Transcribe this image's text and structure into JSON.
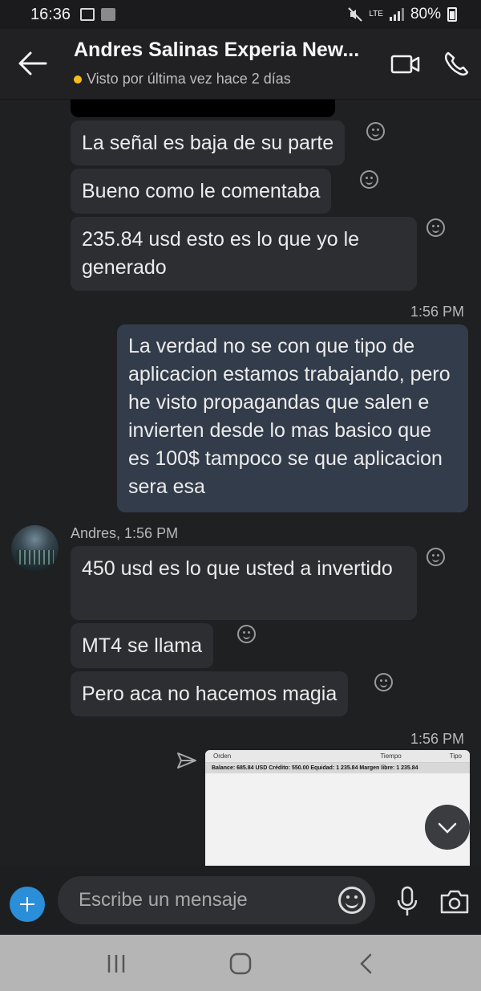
{
  "status_bar": {
    "time": "16:36",
    "network": "LTE",
    "battery": "80%"
  },
  "header": {
    "title": "Andres Salinas Experia New...",
    "subtitle": "Visto por última vez hace 2 días",
    "presence_color": "#f6be1a"
  },
  "messages": {
    "incoming_1": [
      "La señal es baja de su parte",
      "Bueno como le comentaba",
      "235.84 usd esto es lo que yo le generado"
    ],
    "ts_1": "1:56 PM",
    "outgoing_1": "La verdad no se con que tipo de aplicacion estamos trabajando, pero he visto propagandas que salen e invierten desde lo mas basico que es 100$ tampoco se que aplicacion sera esa",
    "sender_line": "Andres, 1:56 PM",
    "incoming_2": [
      "450 usd es lo que usted a invertido",
      "MT4 se llama",
      "Pero aca no hacemos magia"
    ],
    "ts_2": "1:56 PM",
    "image": {
      "col_orden": "Orden",
      "col_tiempo": "Tiempo",
      "col_tipo": "Tipo",
      "balance_line": "Balance: 685.84 USD  Crédito: 550.00  Equidad: 1 235.84  Margen libre: 1 235.84"
    }
  },
  "composer": {
    "placeholder": "Escribe un mensaje"
  },
  "colors": {
    "accent": "#2a8fd8",
    "outgoing_bubble": "#333c4b",
    "incoming_bubble": "#2c2e32"
  }
}
